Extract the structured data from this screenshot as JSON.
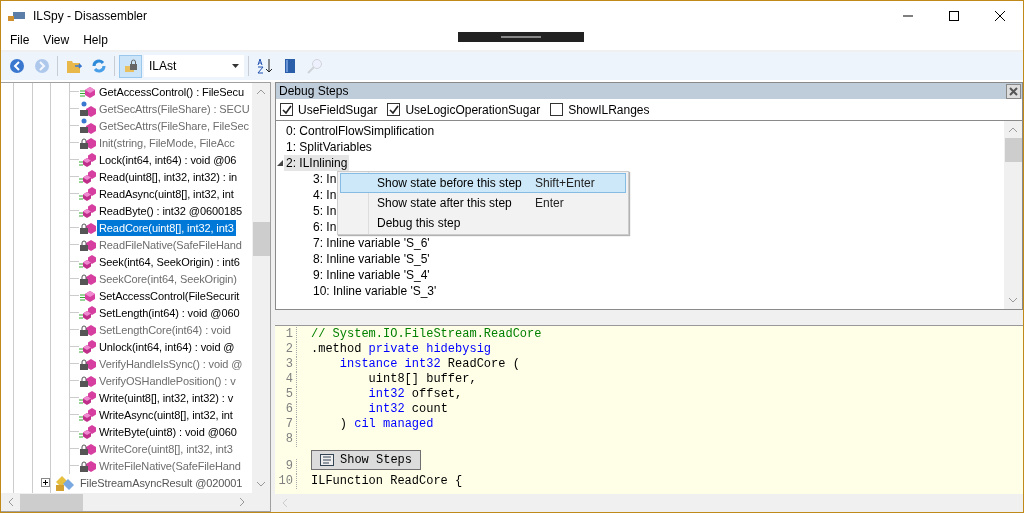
{
  "window": {
    "title": "ILSpy - Disassembler"
  },
  "menu": [
    {
      "label": "File"
    },
    {
      "label": "View"
    },
    {
      "label": "Help"
    }
  ],
  "toolbar": {
    "left": [
      {
        "kind": "back",
        "disabled": false,
        "pressed": false
      },
      {
        "kind": "forward",
        "disabled": true,
        "pressed": false
      },
      {
        "kind": "separator"
      },
      {
        "kind": "open",
        "disabled": false,
        "pressed": false
      },
      {
        "kind": "reload",
        "disabled": false,
        "pressed": false
      },
      {
        "kind": "separator"
      },
      {
        "kind": "lock",
        "disabled": false,
        "pressed": true
      }
    ],
    "language": "ILAst",
    "right": [
      {
        "kind": "separator"
      },
      {
        "kind": "sort",
        "disabled": false,
        "pressed": false
      },
      {
        "kind": "book",
        "disabled": false,
        "pressed": false
      },
      {
        "kind": "search",
        "disabled": true,
        "pressed": false
      }
    ]
  },
  "tree": {
    "items": [
      {
        "label": "GetAccessControl() : FileSecu",
        "kind": "method",
        "selected": false
      },
      {
        "label": "GetSecAttrs(FileShare) : SECU",
        "kind": "security",
        "selected": false
      },
      {
        "label": "GetSecAttrs(FileShare, FileSec",
        "kind": "security",
        "selected": false
      },
      {
        "label": "Init(string, FileMode, FileAcc",
        "kind": "private",
        "selected": false
      },
      {
        "label": "Lock(int64, int64) : void @06",
        "kind": "stacked",
        "selected": false
      },
      {
        "label": "Read(uint8[], int32, int32) : in",
        "kind": "stacked",
        "selected": false
      },
      {
        "label": "ReadAsync(uint8[], int32, int",
        "kind": "stacked",
        "selected": false
      },
      {
        "label": "ReadByte() : int32 @0600185",
        "kind": "stacked",
        "selected": false
      },
      {
        "label": "ReadCore(uint8[], int32, int3",
        "kind": "private",
        "selected": true
      },
      {
        "label": "ReadFileNative(SafeFileHand",
        "kind": "private",
        "selected": false
      },
      {
        "label": "Seek(int64, SeekOrigin) : int6",
        "kind": "stacked",
        "selected": false
      },
      {
        "label": "SeekCore(int64, SeekOrigin)",
        "kind": "private",
        "selected": false
      },
      {
        "label": "SetAccessControl(FileSecurit",
        "kind": "method",
        "selected": false
      },
      {
        "label": "SetLength(int64) : void @060",
        "kind": "stacked",
        "selected": false
      },
      {
        "label": "SetLengthCore(int64) : void",
        "kind": "private",
        "selected": false
      },
      {
        "label": "Unlock(int64, int64) : void @",
        "kind": "stacked",
        "selected": false
      },
      {
        "label": "VerifyHandleIsSync() : void @",
        "kind": "private",
        "selected": false
      },
      {
        "label": "VerifyOSHandlePosition() : v",
        "kind": "private",
        "selected": false
      },
      {
        "label": "Write(uint8[], int32, int32) : v",
        "kind": "stacked",
        "selected": false
      },
      {
        "label": "WriteAsync(uint8[], int32, int",
        "kind": "stacked",
        "selected": false
      },
      {
        "label": "WriteByte(uint8) : void @060",
        "kind": "stacked",
        "selected": false
      },
      {
        "label": "WriteCore(uint8[], int32, int3",
        "kind": "private",
        "selected": false
      },
      {
        "label": "WriteFileNative(SafeFileHand",
        "kind": "private",
        "selected": false
      }
    ],
    "next_type": {
      "label": "FileStreamAsyncResult @020001",
      "expanded": false
    }
  },
  "debug_steps": {
    "title": "Debug Steps",
    "options": [
      {
        "label": "UseFieldSugar",
        "checked": true
      },
      {
        "label": "UseLogicOperationSugar",
        "checked": true
      },
      {
        "label": "ShowILRanges",
        "checked": false
      }
    ],
    "steps": [
      {
        "label": "0: ControlFlowSimplification",
        "selected": false
      },
      {
        "label": "1: SplitVariables",
        "selected": false
      },
      {
        "label": "2: ILInlining",
        "selected": true,
        "expanded": true,
        "children": [
          {
            "label": "3: In",
            "selected": false
          },
          {
            "label": "4: In",
            "selected": false
          },
          {
            "label": "5: In",
            "selected": false
          },
          {
            "label": "6: In",
            "selected": false
          },
          {
            "label": "7: Inline variable 'S_6'",
            "selected": false
          },
          {
            "label": "8: Inline variable 'S_5'",
            "selected": false
          },
          {
            "label": "9: Inline variable 'S_4'",
            "selected": false
          },
          {
            "label": "10: Inline variable 'S_3'",
            "selected": false
          }
        ]
      }
    ],
    "context_menu": [
      {
        "label": "Show state before this step",
        "shortcut": "Shift+Enter",
        "selected": true
      },
      {
        "label": "Show state after this step",
        "shortcut": "Enter",
        "selected": false
      },
      {
        "label": "Debug this step",
        "selected": false
      }
    ]
  },
  "code": {
    "lines": [
      {
        "number": "1",
        "tokens": [
          {
            "kind": "comment",
            "text": "// System.IO.FileStream.ReadCore"
          }
        ]
      },
      {
        "number": "2",
        "tokens": [
          {
            "kind": "plain",
            "text": ".method "
          },
          {
            "kind": "keyword",
            "text": "private hidebysig"
          }
        ]
      },
      {
        "number": "3",
        "tokens": [
          {
            "kind": "keyword",
            "text": "    instance int32"
          },
          {
            "kind": "plain",
            "text": " ReadCore ("
          }
        ]
      },
      {
        "number": "4",
        "tokens": [
          {
            "kind": "plain",
            "text": "        uint8[] buffer,"
          }
        ]
      },
      {
        "number": "5",
        "tokens": [
          {
            "kind": "keyword",
            "text": "        int32"
          },
          {
            "kind": "plain",
            "text": " offset,"
          }
        ]
      },
      {
        "number": "6",
        "tokens": [
          {
            "kind": "keyword",
            "text": "        int32"
          },
          {
            "kind": "plain",
            "text": " count"
          }
        ]
      },
      {
        "number": "7",
        "tokens": [
          {
            "kind": "plain",
            "text": "    ) "
          },
          {
            "kind": "keyword",
            "text": "cil managed"
          }
        ]
      },
      {
        "number": "8"
      },
      {
        "number": "9",
        "button": "Show Steps"
      },
      {
        "number": "10",
        "tokens": [
          {
            "kind": "plain",
            "text": "ILFunction ReadCore {"
          }
        ]
      }
    ]
  }
}
